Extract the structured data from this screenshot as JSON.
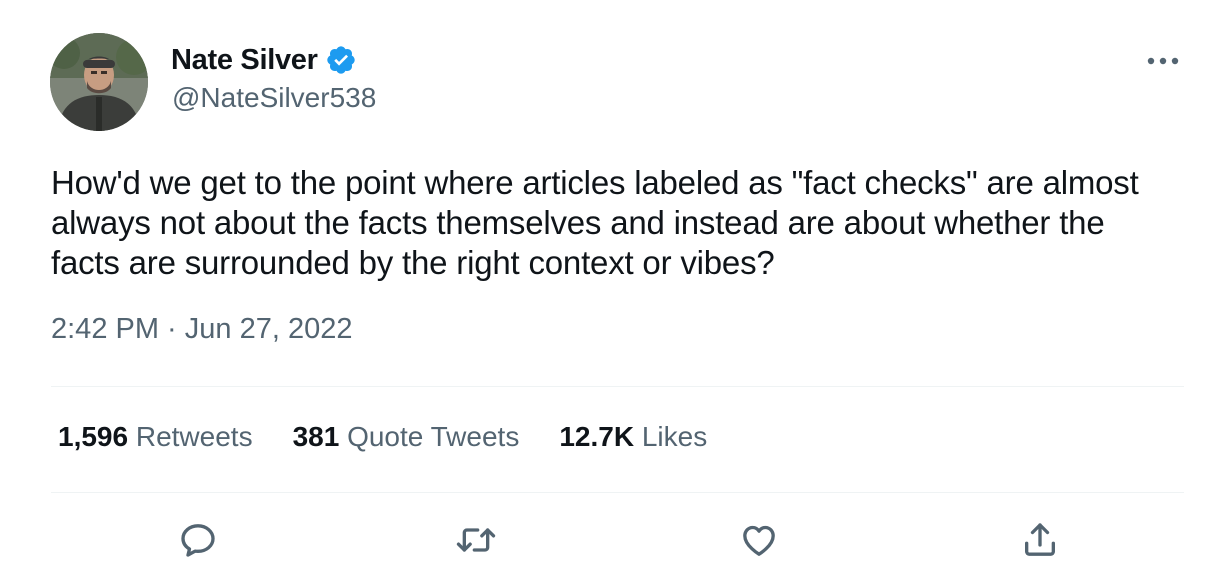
{
  "author": {
    "display_name": "Nate Silver",
    "handle": "@NateSilver538",
    "verified": true
  },
  "tweet": {
    "text": "How'd we get to the point where articles labeled as \"fact checks\" are almost always not about the facts themselves and instead are about whether the facts are surrounded by the right context or vibes?",
    "timestamp": "2:42 PM · Jun 27, 2022"
  },
  "stats": {
    "retweets_count": "1,596",
    "retweets_label": "Retweets",
    "quotes_count": "381",
    "quotes_label": "Quote Tweets",
    "likes_count": "12.7K",
    "likes_label": "Likes"
  },
  "icons": {
    "more": "more-dots-icon",
    "verified": "verified-badge-icon",
    "reply": "reply-icon",
    "retweet": "retweet-icon",
    "like": "like-icon",
    "share": "share-icon"
  },
  "colors": {
    "text_primary": "#0f1419",
    "text_secondary": "#536471",
    "verified_blue": "#1d9bf0",
    "divider": "#eff3f4"
  }
}
